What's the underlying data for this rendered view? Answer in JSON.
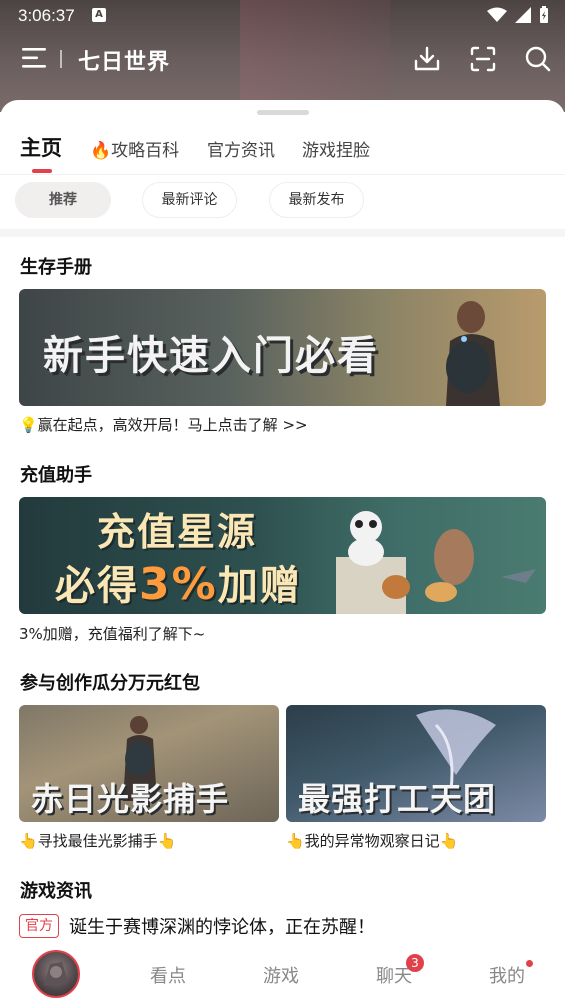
{
  "status_bar": {
    "time": "3:06:37",
    "notification_icon": "A"
  },
  "header": {
    "title": "七日世界",
    "icons": [
      "menu-icon",
      "download-icon",
      "scan-icon",
      "search-icon"
    ]
  },
  "tabs": [
    {
      "label": "主页",
      "active": true
    },
    {
      "label": "攻略百科",
      "icon": "🔥"
    },
    {
      "label": "官方资讯"
    },
    {
      "label": "游戏捏脸"
    }
  ],
  "chips": [
    {
      "label": "推荐",
      "active": true
    },
    {
      "label": "最新评论"
    },
    {
      "label": "最新发布"
    }
  ],
  "sections": {
    "survival": {
      "title": "生存手册",
      "banner_text": "新手快速入门必看",
      "caption": "💡赢在起点，高效开局！马上点击了解 >>"
    },
    "recharge": {
      "title": "充值助手",
      "banner_line1": "充值星源",
      "banner_line2_pre": "必得",
      "banner_line2_pct": "3%",
      "banner_line2_post": "加赠",
      "caption": "3%加赠，充值福利了解下~"
    },
    "creation": {
      "title": "参与创作瓜分万元红包",
      "left_banner_text": "赤日光影捕手",
      "left_caption": "👆寻找最佳光影捕手👆",
      "right_banner_text": "最强打工天团",
      "right_caption": "👆我的异常物观察日记👆"
    },
    "news": {
      "title": "游戏资讯",
      "tag": "官方",
      "headline": "诞生于赛博深渊的悖论体，正在苏醒！"
    }
  },
  "bottom_nav": {
    "items": [
      "看点",
      "游戏",
      "聊天",
      "我的"
    ],
    "chat_badge": "3"
  },
  "colors": {
    "accent": "#e0424c",
    "header_bg": "#5a4f4f"
  }
}
